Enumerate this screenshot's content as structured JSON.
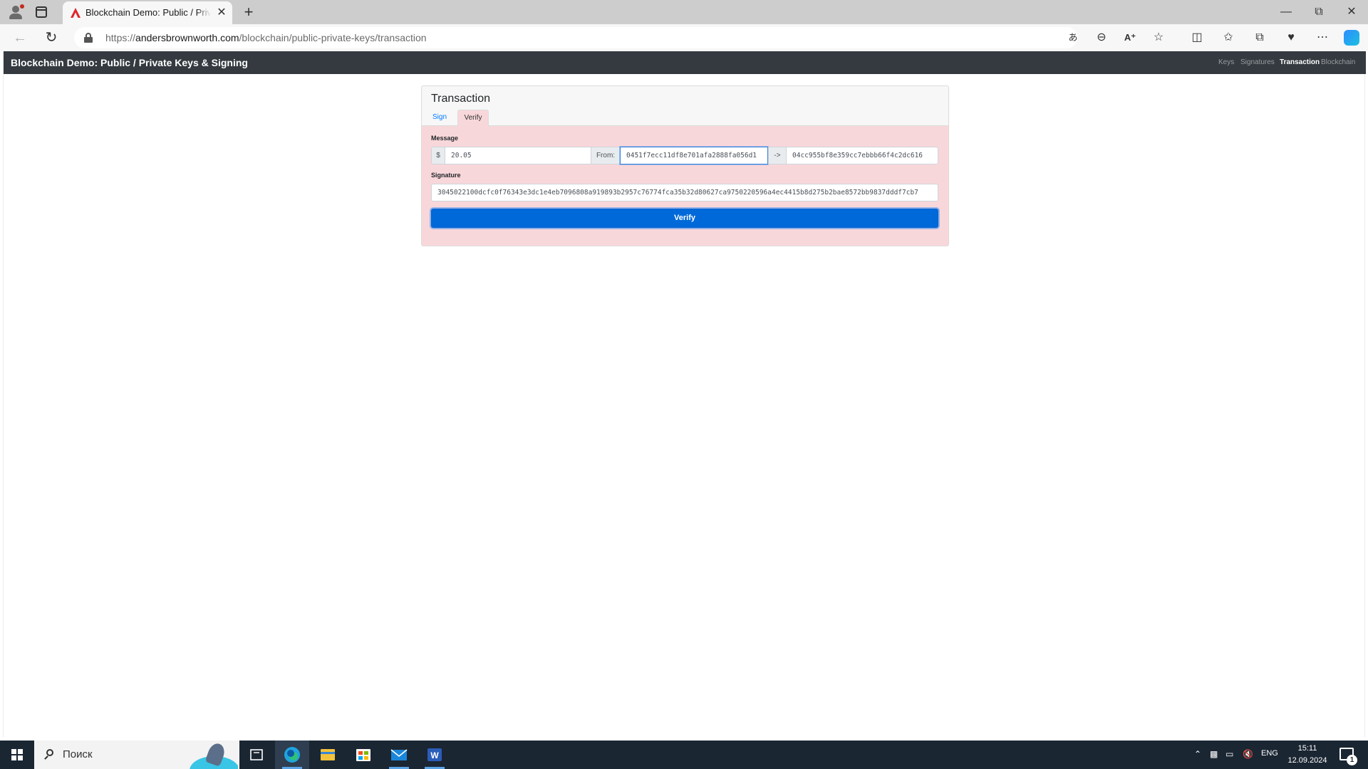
{
  "browser": {
    "tab_title": "Blockchain Demo: Public / Private Keys & Signing",
    "url_scheme": "https://",
    "url_host": "andersbrownworth.com",
    "url_path": "/blockchain/public-private-keys/transaction",
    "new_tab_glyph": "+",
    "close_glyph": "✕"
  },
  "site": {
    "brand": "Blockchain Demo: Public / Private Keys & Signing",
    "nav": [
      "Keys",
      "Signatures",
      "Transaction",
      "Blockchain"
    ],
    "active_nav": "Transaction"
  },
  "card": {
    "title": "Transaction",
    "tabs": [
      "Sign",
      "Verify"
    ],
    "active_tab": "Verify",
    "message_label": "Message",
    "currency_symbol": "$",
    "amount": "20.05",
    "from_label": "From:",
    "from_value": "0451f7ecc11df8e701afa2888fa056d1",
    "arrow": "->",
    "to_value": "04cc955bf8e359cc7ebbb66f4c2dc616",
    "signature_label": "Signature",
    "signature_value": "3045022100dcfc0f76343e3dc1e4eb7096808a919893b2957c76774fca35b32d80627ca9750220596a4ec4415b8d275b2bae8572bb9837dddf7cb7",
    "verify_button": "Verify"
  },
  "taskbar": {
    "search_placeholder": "Поиск",
    "language": "ENG",
    "time": "15:11",
    "date": "12.09.2024",
    "notification_count": "1"
  },
  "colors": {
    "navbar": "#343a40",
    "card_bg": "#f8d7da",
    "verify_button": "#0069d9",
    "link": "#007bff"
  },
  "icons": [
    "profile-icon",
    "tab-actions-icon",
    "reload-icon",
    "back-icon",
    "lock-icon",
    "translate-icon",
    "zoom-out-icon",
    "read-aloud-icon",
    "favorite-icon",
    "split-screen-icon",
    "favorites-icon",
    "collections-icon",
    "browser-essentials-icon",
    "more-icon",
    "copilot-icon",
    "windows-icon",
    "search-icon",
    "task-view-icon",
    "edge-icon",
    "file-explorer-icon",
    "store-icon",
    "mail-icon",
    "word-icon"
  ]
}
